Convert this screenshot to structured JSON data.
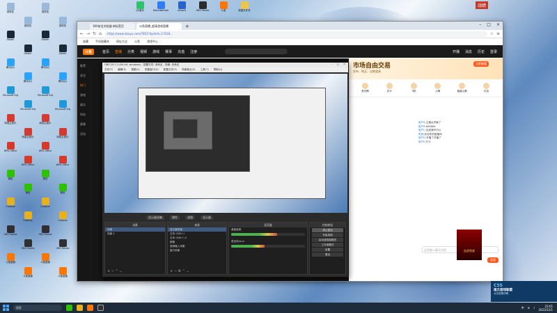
{
  "desktop": {
    "icons_left": [
      {
        "label": "回收站",
        "color": "#9ab8d8"
      },
      {
        "label": "Steam",
        "color": "#1b2838"
      },
      {
        "label": "腾讯QQ",
        "color": "#2aa3ff"
      },
      {
        "label": "Microsoft Edge",
        "color": "#1f9ad6"
      },
      {
        "label": "网易云音乐",
        "color": "#d33a31"
      },
      {
        "label": "WPS Office",
        "color": "#d63a2a"
      },
      {
        "label": "微信",
        "color": "#2ec100"
      },
      {
        "label": "Chrome",
        "color": "#e8b01a"
      },
      {
        "label": "OBS Studio",
        "color": "#302e31"
      },
      {
        "label": "斗鱼直播",
        "color": "#ff7700"
      }
    ],
    "icons_top": [
      {
        "label": "QQ音乐",
        "color": "#2fc46b"
      },
      {
        "label": "BaiduNetdisk",
        "color": "#2f7cf6"
      },
      {
        "label": "Ubisoft",
        "color": "#2a62c8"
      },
      {
        "label": "OBS Studio",
        "color": "#2b2b2b"
      },
      {
        "label": "斗鱼",
        "color": "#ff7700"
      },
      {
        "label": "新建文件夹",
        "color": "#f0c34a"
      }
    ],
    "corner_tag": "战绩"
  },
  "browser": {
    "tabs": [
      "360安全浏览器 新标签页",
      "斗鱼直播_超清游戏直播"
    ],
    "url": "https://www.douyu.com/7851?dyshid=17018...",
    "bookmarks": [
      "收藏",
      "手机收藏夹",
      "网址大全",
      "斗鱼",
      "游戏中心"
    ],
    "site": {
      "logo": "斗鱼",
      "nav": [
        "首页",
        "直播",
        "分类",
        "视频",
        "游戏",
        "赛事",
        "充值",
        "注册"
      ],
      "active_nav": "直播",
      "right": [
        "开播",
        "消息",
        "历史",
        "登录"
      ],
      "sidebar": [
        "推荐",
        "关注",
        "热门",
        "游戏",
        "娱乐",
        "科技",
        "赛事",
        "活动"
      ],
      "promo": {
        "title": "市场自由交易",
        "subtitle": "发布、购买、出售道具",
        "button": "立即查看"
      },
      "gifts": [
        "荧光棒",
        "办卡",
        "飞机",
        "火箭",
        "超级火箭",
        "礼包"
      ],
      "chat": [
        {
          "nick": "用户A:",
          "text": "主播太厉害了"
        },
        {
          "nick": "用户B:",
          "text": "666666"
        },
        {
          "nick": "用户C:",
          "text": "这波操作可以"
        },
        {
          "nick": "系统:",
          "text": "欢迎来到直播间"
        },
        {
          "nick": "用户D:",
          "text": "开播了开播了"
        },
        {
          "nick": "用户E:",
          "text": "打卡"
        }
      ],
      "chat_placeholder": "这里输入聊天内容",
      "send_label": "发送",
      "ad_label": "血战到底"
    }
  },
  "obs": {
    "title": "OBS 29.1.3 (64-bit, windows) - 配置文件: 未命名 - 场景: 未命名",
    "menu": [
      "文件(F)",
      "编辑(E)",
      "视图(V)",
      "停靠窗口(D)",
      "配置文件(P)",
      "场景集合(S)",
      "工具(T)",
      "帮助(H)"
    ],
    "status": [
      "显示器采集",
      "属性",
      "滤镜",
      "显示器"
    ],
    "docks": {
      "scenes": {
        "title": "场景",
        "items": [
          "场景",
          "场景 2"
        ]
      },
      "sources": {
        "title": "来源",
        "items": [
          "显示器采集",
          "文本 (GDI+)",
          "文本 (GDI+) 2",
          "图像",
          "音频输入采集",
          "窗口采集"
        ]
      },
      "mixer": {
        "title": "混音器",
        "channels": [
          "桌面音频",
          "麦克风/Aux"
        ],
        "levels": [
          0.62,
          0.45
        ]
      },
      "controls": {
        "title": "控制按钮",
        "buttons": [
          "停止推流",
          "开始录制",
          "启动虚拟摄像机",
          "工作室模式",
          "设置",
          "退出"
        ]
      }
    }
  },
  "toast": {
    "logo": "CSS",
    "title": "南方游戏联盟",
    "subtitle": "点击查看详情"
  },
  "taskbar": {
    "search_placeholder": "搜索",
    "time": "23:01",
    "date": "2023/12/1",
    "lang": "中"
  }
}
